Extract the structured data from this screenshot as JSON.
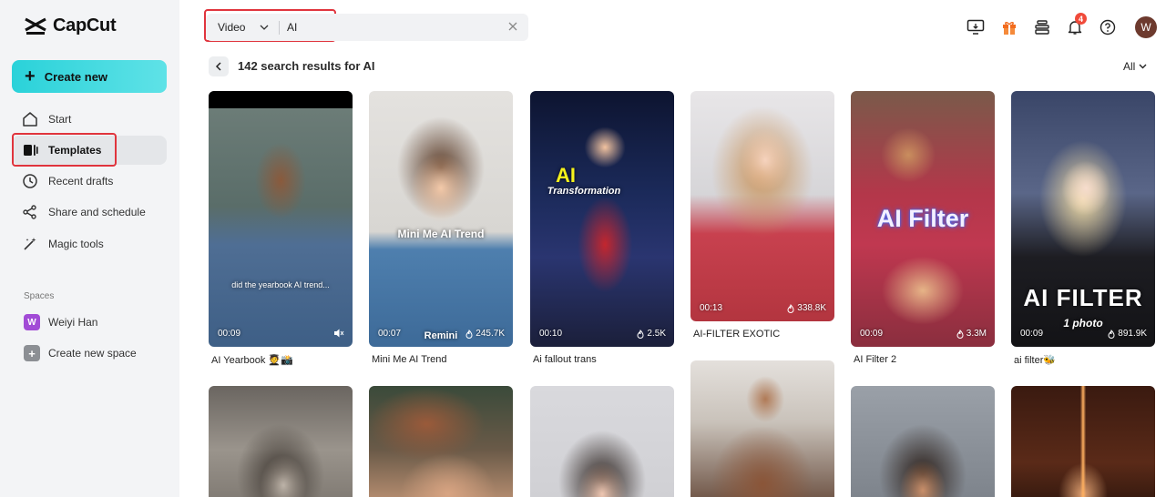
{
  "brand": {
    "name": "CapCut"
  },
  "sidebar": {
    "create_label": "Create new",
    "items": [
      {
        "label": "Start"
      },
      {
        "label": "Templates"
      },
      {
        "label": "Recent drafts"
      },
      {
        "label": "Share and schedule"
      },
      {
        "label": "Magic tools"
      }
    ],
    "spaces_label": "Spaces",
    "spaces": [
      {
        "avatar": "W",
        "label": "Weiyi Han"
      },
      {
        "avatar": "+",
        "label": "Create new space"
      }
    ]
  },
  "search": {
    "type": "Video",
    "query": "AI"
  },
  "topbar": {
    "notification_count": "4",
    "avatar_initial": "W"
  },
  "results": {
    "title": "142 search results for AI",
    "filter": "All"
  },
  "templates": [
    {
      "title": "AI Yearbook 🧑‍🎓📸",
      "duration": "00:09",
      "uses": "",
      "caption": "did the yearbook AI trend..."
    },
    {
      "title": "Mini Me AI Trend",
      "duration": "00:07",
      "uses": "245.7K",
      "caption": "Mini Me AI Trend",
      "watermark": "Remini"
    },
    {
      "title": "Ai fallout trans",
      "duration": "00:10",
      "uses": "2.5K",
      "caption": "AI",
      "caption2": "Transformation"
    },
    {
      "title": "AI-FILTER EXOTIC",
      "duration": "00:13",
      "uses": "338.8K"
    },
    {
      "title": "AI Filter 2",
      "duration": "00:09",
      "uses": "3.3M",
      "caption": "AI Filter"
    },
    {
      "title": "ai filter🐝",
      "duration": "00:09",
      "uses": "891.9K",
      "caption": "AI FILTER",
      "caption2": "1 photo"
    }
  ],
  "colors": {
    "accent": "#2ad2d9",
    "highlight": "#e0343d",
    "sidebar_bg": "#f3f4f6",
    "badge": "#f04a3a"
  }
}
